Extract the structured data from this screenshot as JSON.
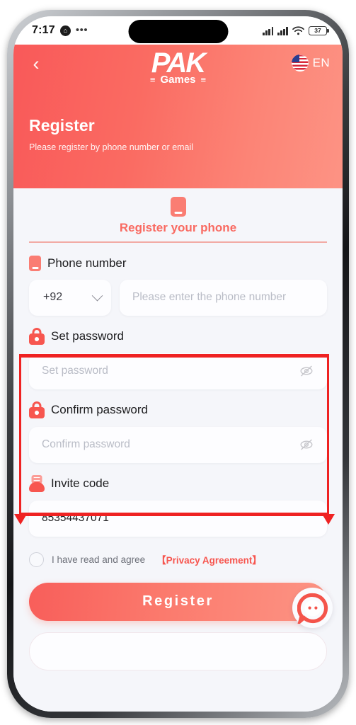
{
  "status_bar": {
    "time": "7:17",
    "app_icon": "home-icon",
    "overflow": "•••",
    "battery_percent": "37",
    "icons": [
      "signal-icon",
      "signal-icon",
      "wifi-icon",
      "battery-icon"
    ]
  },
  "header": {
    "back_icon": "chevron-left-icon",
    "brand_main": "PAK",
    "brand_sub": "Games",
    "brand_bar_left": "≡",
    "brand_bar_right": "≡",
    "flag_icon": "us-flag-icon",
    "language": "EN",
    "title": "Register",
    "subtitle": "Please register by phone number or email",
    "gradient_from": "#f95959",
    "gradient_to": "#fd9384"
  },
  "tab": {
    "icon": "phone-icon",
    "label": "Register your phone",
    "active_color": "#f96a61"
  },
  "phone_field": {
    "icon": "phone-icon",
    "label": "Phone number",
    "country_code": "+92",
    "dropdown_icon": "chevron-down-icon",
    "placeholder": "Please enter the phone number",
    "value": ""
  },
  "set_password_field": {
    "icon": "lock-icon",
    "label": "Set password",
    "placeholder": "Set password",
    "value": "",
    "toggle_icon": "eye-off-icon"
  },
  "confirm_password_field": {
    "icon": "lock-icon",
    "label": "Confirm password",
    "placeholder": "Confirm password",
    "value": "",
    "toggle_icon": "eye-off-icon"
  },
  "invite_field": {
    "icon": "invite-code-icon",
    "label": "Invite code",
    "value": "85354437071",
    "placeholder": "Invite code"
  },
  "agreement": {
    "checkbox_state": "unchecked",
    "text": "I have read and agree",
    "link": "【Privacy Agreement】",
    "link_color": "#f7564f"
  },
  "actions": {
    "register_label": "Register"
  },
  "chat_fab": {
    "icon": "customer-service-chat-icon"
  },
  "annotation": {
    "color": "#ef2222",
    "shape": "rectangle-with-down-arrows",
    "targets": [
      "set_password_field",
      "confirm_password_field"
    ]
  }
}
